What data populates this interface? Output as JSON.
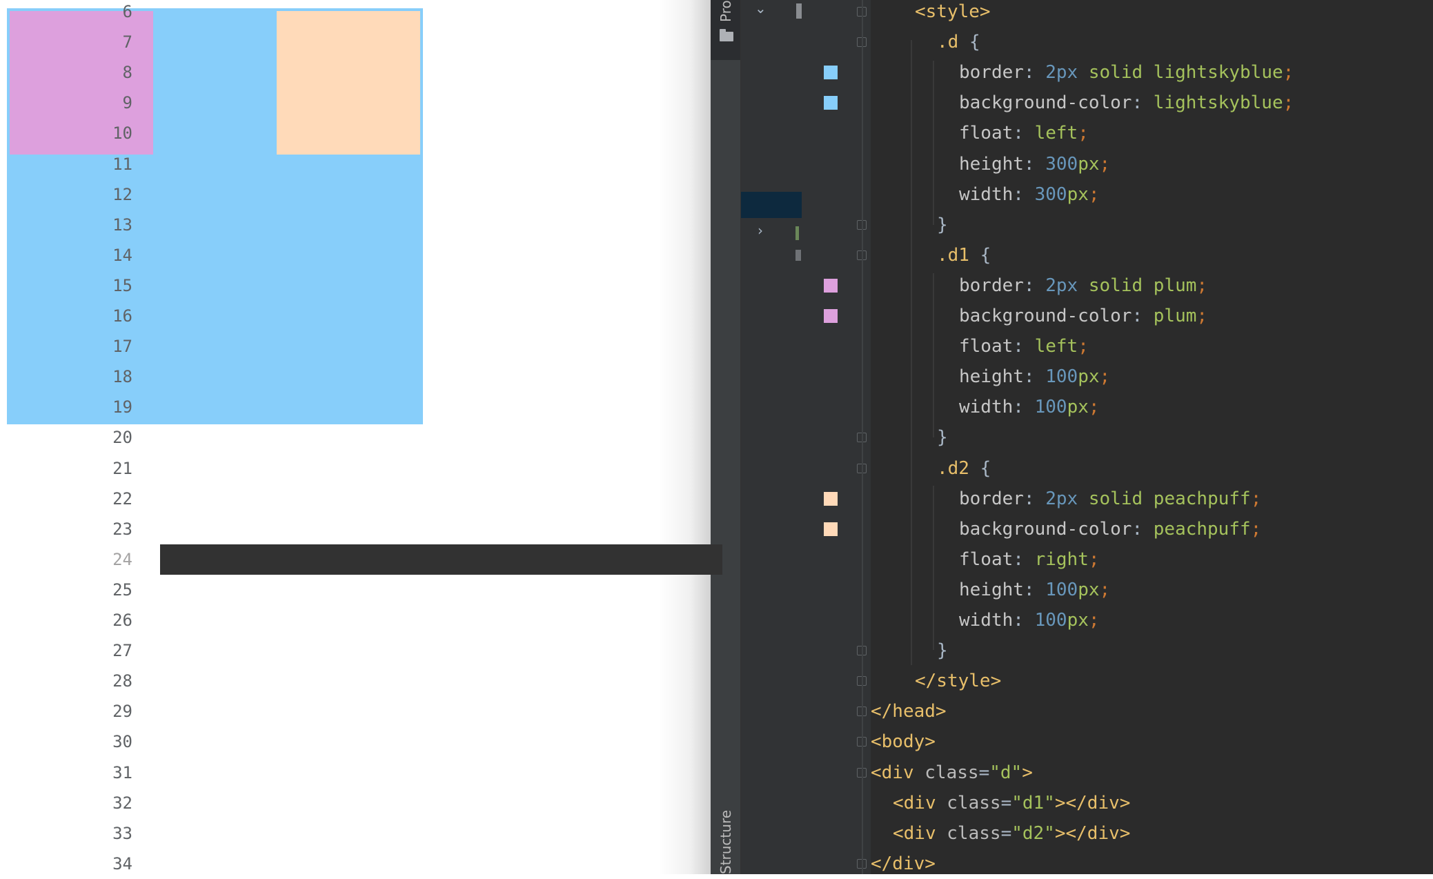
{
  "preview": {
    "container_color": "#87cefa",
    "child1_color": "#dda0dd",
    "child2_color": "#ffdab9"
  },
  "ide": {
    "tool_windows": {
      "project_label": "Pro",
      "structure_label": "Structure"
    },
    "current_line": "24",
    "lines": [
      {
        "n": "6",
        "indent": 2,
        "parts": [
          [
            "tag",
            "<style>"
          ]
        ]
      },
      {
        "n": "7",
        "indent": 3,
        "parts": [
          [
            "sel",
            ".d"
          ],
          [
            "plain",
            " {"
          ]
        ]
      },
      {
        "n": "8",
        "indent": 4,
        "swatch": "#87cefa",
        "parts": [
          [
            "prop",
            "border"
          ],
          [
            "plain",
            ": "
          ],
          [
            "num",
            "2px"
          ],
          [
            "plain",
            " "
          ],
          [
            "val",
            "solid"
          ],
          [
            "plain",
            " "
          ],
          [
            "val",
            "lightskyblue"
          ],
          [
            "punct",
            ";"
          ]
        ]
      },
      {
        "n": "9",
        "indent": 4,
        "swatch": "#87cefa",
        "parts": [
          [
            "prop",
            "background-color"
          ],
          [
            "plain",
            ": "
          ],
          [
            "val",
            "lightskyblue"
          ],
          [
            "punct",
            ";"
          ]
        ]
      },
      {
        "n": "10",
        "indent": 4,
        "parts": [
          [
            "prop",
            "float"
          ],
          [
            "plain",
            ": "
          ],
          [
            "val",
            "left"
          ],
          [
            "punct",
            ";"
          ]
        ]
      },
      {
        "n": "11",
        "indent": 4,
        "parts": [
          [
            "prop",
            "height"
          ],
          [
            "plain",
            ": "
          ],
          [
            "num",
            "300"
          ],
          [
            "val",
            "px"
          ],
          [
            "punct",
            ";"
          ]
        ]
      },
      {
        "n": "12",
        "indent": 4,
        "parts": [
          [
            "prop",
            "width"
          ],
          [
            "plain",
            ": "
          ],
          [
            "num",
            "300"
          ],
          [
            "val",
            "px"
          ],
          [
            "punct",
            ";"
          ]
        ]
      },
      {
        "n": "13",
        "indent": 3,
        "parts": [
          [
            "plain",
            "}"
          ]
        ]
      },
      {
        "n": "14",
        "indent": 3,
        "parts": [
          [
            "sel",
            ".d1"
          ],
          [
            "plain",
            " {"
          ]
        ]
      },
      {
        "n": "15",
        "indent": 4,
        "swatch": "#dda0dd",
        "parts": [
          [
            "prop",
            "border"
          ],
          [
            "plain",
            ": "
          ],
          [
            "num",
            "2px"
          ],
          [
            "plain",
            " "
          ],
          [
            "val",
            "solid"
          ],
          [
            "plain",
            " "
          ],
          [
            "val",
            "plum"
          ],
          [
            "punct",
            ";"
          ]
        ]
      },
      {
        "n": "16",
        "indent": 4,
        "swatch": "#dda0dd",
        "parts": [
          [
            "prop",
            "background-color"
          ],
          [
            "plain",
            ": "
          ],
          [
            "val",
            "plum"
          ],
          [
            "punct",
            ";"
          ]
        ]
      },
      {
        "n": "17",
        "indent": 4,
        "parts": [
          [
            "prop",
            "float"
          ],
          [
            "plain",
            ": "
          ],
          [
            "val",
            "left"
          ],
          [
            "punct",
            ";"
          ]
        ]
      },
      {
        "n": "18",
        "indent": 4,
        "parts": [
          [
            "prop",
            "height"
          ],
          [
            "plain",
            ": "
          ],
          [
            "num",
            "100"
          ],
          [
            "val",
            "px"
          ],
          [
            "punct",
            ";"
          ]
        ]
      },
      {
        "n": "19",
        "indent": 4,
        "parts": [
          [
            "prop",
            "width"
          ],
          [
            "plain",
            ": "
          ],
          [
            "num",
            "100"
          ],
          [
            "val",
            "px"
          ],
          [
            "punct",
            ";"
          ]
        ]
      },
      {
        "n": "20",
        "indent": 3,
        "parts": [
          [
            "plain",
            "}"
          ]
        ]
      },
      {
        "n": "21",
        "indent": 3,
        "parts": [
          [
            "sel",
            ".d2"
          ],
          [
            "plain",
            " {"
          ]
        ]
      },
      {
        "n": "22",
        "indent": 4,
        "swatch": "#ffdab9",
        "parts": [
          [
            "prop",
            "border"
          ],
          [
            "plain",
            ": "
          ],
          [
            "num",
            "2px"
          ],
          [
            "plain",
            " "
          ],
          [
            "val",
            "solid"
          ],
          [
            "plain",
            " "
          ],
          [
            "val",
            "peachpuff"
          ],
          [
            "punct",
            ";"
          ]
        ]
      },
      {
        "n": "23",
        "indent": 4,
        "swatch": "#ffdab9",
        "parts": [
          [
            "prop",
            "background-color"
          ],
          [
            "plain",
            ": "
          ],
          [
            "val",
            "peachpuff"
          ],
          [
            "punct",
            ";"
          ]
        ]
      },
      {
        "n": "24",
        "indent": 4,
        "parts": [
          [
            "prop",
            "float"
          ],
          [
            "plain",
            ": "
          ],
          [
            "val",
            "right"
          ],
          [
            "punct",
            ";"
          ]
        ]
      },
      {
        "n": "25",
        "indent": 4,
        "parts": [
          [
            "prop",
            "height"
          ],
          [
            "plain",
            ": "
          ],
          [
            "num",
            "100"
          ],
          [
            "val",
            "px"
          ],
          [
            "punct",
            ";"
          ]
        ]
      },
      {
        "n": "26",
        "indent": 4,
        "parts": [
          [
            "prop",
            "width"
          ],
          [
            "plain",
            ": "
          ],
          [
            "num",
            "100"
          ],
          [
            "val",
            "px"
          ],
          [
            "punct",
            ";"
          ]
        ]
      },
      {
        "n": "27",
        "indent": 3,
        "parts": [
          [
            "plain",
            "}"
          ]
        ]
      },
      {
        "n": "28",
        "indent": 2,
        "parts": [
          [
            "tag",
            "</style>"
          ]
        ]
      },
      {
        "n": "29",
        "indent": 0,
        "parts": [
          [
            "tag",
            "</head>"
          ]
        ]
      },
      {
        "n": "30",
        "indent": 0,
        "parts": [
          [
            "tag",
            "<body>"
          ]
        ]
      },
      {
        "n": "31",
        "indent": 0,
        "parts": [
          [
            "tag",
            "<div "
          ],
          [
            "attr",
            "class"
          ],
          [
            "plain",
            "="
          ],
          [
            "str",
            "\"d\""
          ],
          [
            "tag",
            ">"
          ]
        ]
      },
      {
        "n": "32",
        "indent": 1,
        "parts": [
          [
            "tag",
            "<div "
          ],
          [
            "attr",
            "class"
          ],
          [
            "plain",
            "="
          ],
          [
            "str",
            "\"d1\""
          ],
          [
            "tag",
            "></div>"
          ]
        ]
      },
      {
        "n": "33",
        "indent": 1,
        "parts": [
          [
            "tag",
            "<div "
          ],
          [
            "attr",
            "class"
          ],
          [
            "plain",
            "="
          ],
          [
            "str",
            "\"d2\""
          ],
          [
            "tag",
            "></div>"
          ]
        ]
      },
      {
        "n": "34",
        "indent": 0,
        "parts": [
          [
            "tag",
            "</div>"
          ]
        ]
      }
    ]
  }
}
